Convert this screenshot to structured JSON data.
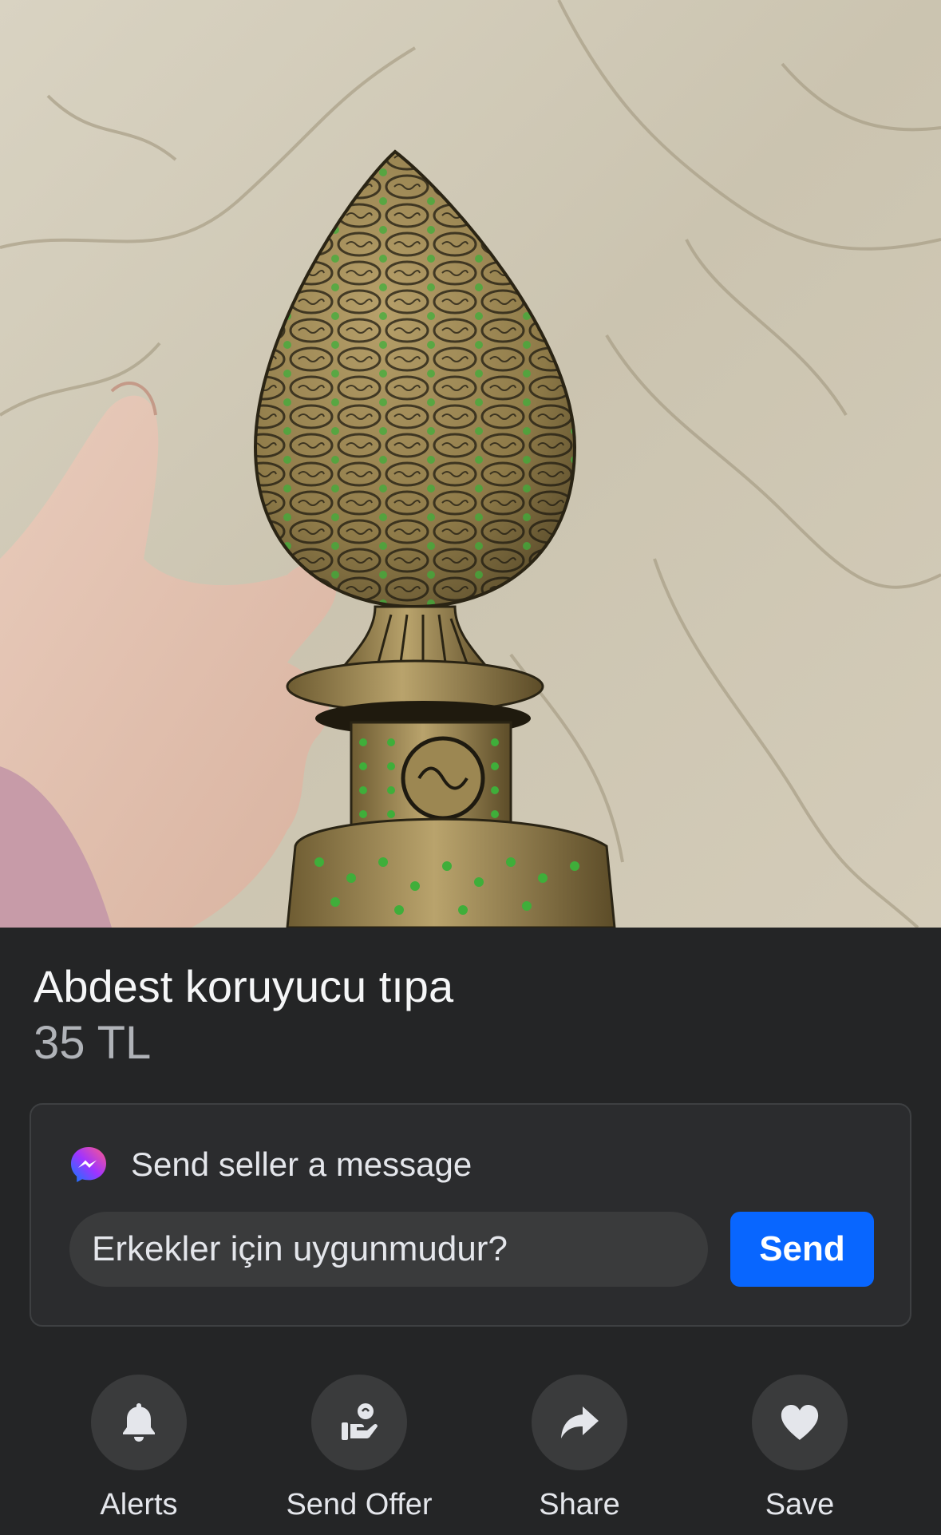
{
  "listing": {
    "title": "Abdest koruyucu tıpa",
    "price": "35 TL"
  },
  "message": {
    "header": "Send seller a message",
    "input_value": "Erkekler için uygunmudur?",
    "send_label": "Send"
  },
  "actions": [
    {
      "label": "Alerts",
      "icon": "bell-icon"
    },
    {
      "label": "Send Offer",
      "icon": "offer-hand-icon"
    },
    {
      "label": "Share",
      "icon": "share-arrow-icon"
    },
    {
      "label": "Save",
      "icon": "heart-icon"
    }
  ],
  "colors": {
    "background": "#242526",
    "card": "#2b2c2e",
    "input": "#3a3b3c",
    "send_button": "#0866ff",
    "text_primary": "#e4e6eb",
    "text_secondary": "#b0b3b8"
  }
}
